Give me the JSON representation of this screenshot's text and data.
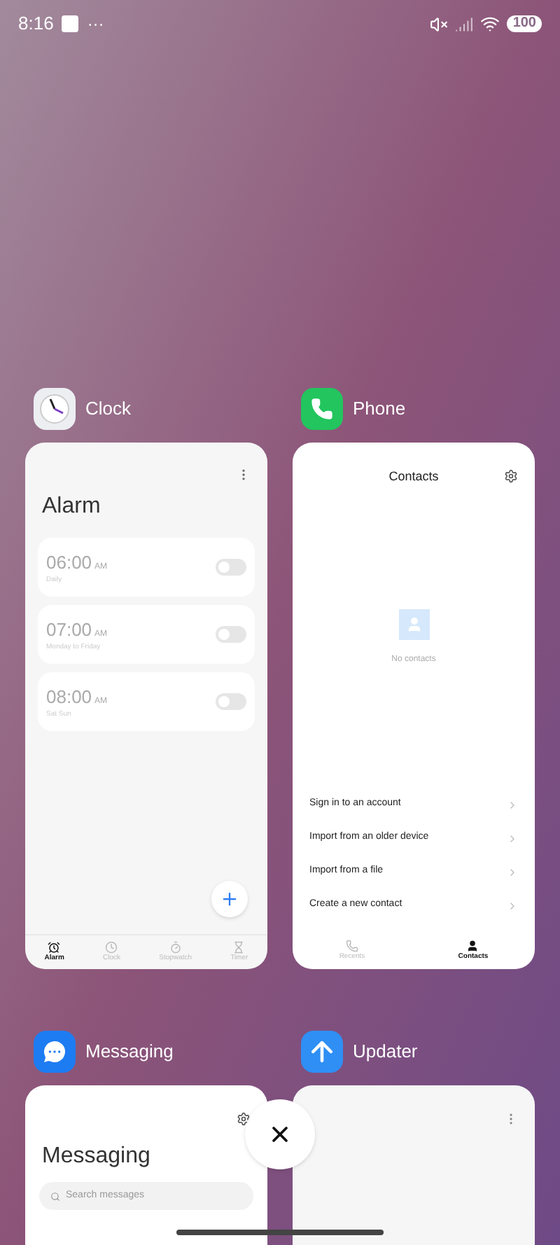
{
  "status_bar": {
    "time": "8:16",
    "more": "···",
    "battery": "100"
  },
  "recent_apps": [
    {
      "kind": "clock",
      "name": "Clock",
      "title": "Alarm",
      "alarms": [
        {
          "time": "06:00",
          "period": "AM",
          "repeat": "Daily",
          "on": false
        },
        {
          "time": "07:00",
          "period": "AM",
          "repeat": "Monday to Friday",
          "on": false
        },
        {
          "time": "08:00",
          "period": "AM",
          "repeat": "Sat Sun",
          "on": false
        }
      ],
      "tabs": [
        {
          "label": "Alarm",
          "selected": true
        },
        {
          "label": "Clock",
          "selected": false
        },
        {
          "label": "Stopwatch",
          "selected": false
        },
        {
          "label": "Timer",
          "selected": false
        }
      ]
    },
    {
      "kind": "phone",
      "name": "Phone",
      "title": "Contacts",
      "empty_text": "No contacts",
      "actions": [
        "Sign in to an account",
        "Import from an older device",
        "Import from a file",
        "Create a new contact"
      ],
      "tabs": [
        {
          "label": "Recents",
          "selected": false
        },
        {
          "label": "Contacts",
          "selected": true
        }
      ]
    },
    {
      "kind": "messaging",
      "name": "Messaging",
      "title": "Messaging",
      "search": {
        "placeholder": "Search messages"
      }
    },
    {
      "kind": "updater",
      "name": "Updater"
    }
  ]
}
